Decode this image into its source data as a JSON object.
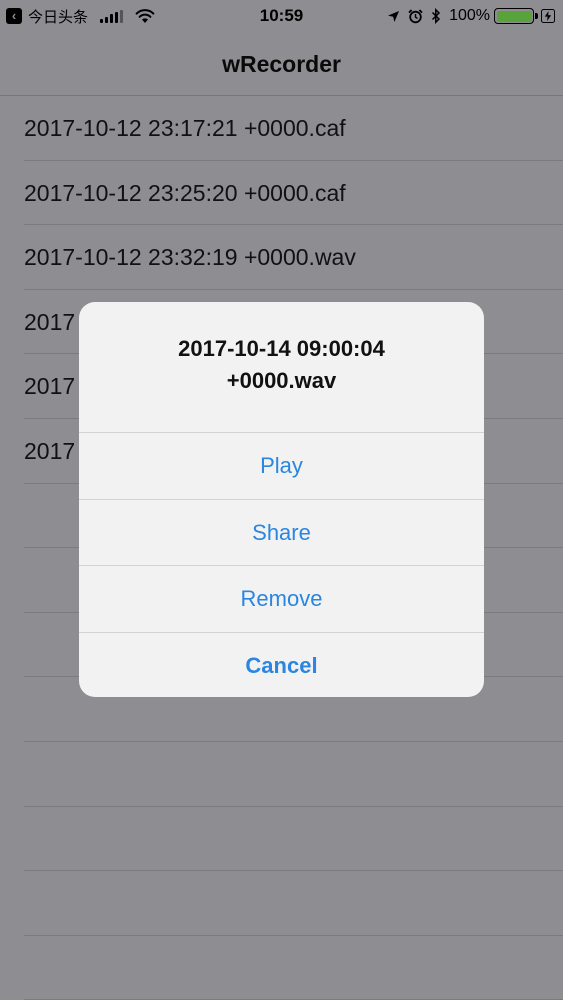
{
  "status_bar": {
    "back_app": "今日头条",
    "time": "10:59",
    "battery_percent": "100%",
    "battery_level": 1.0,
    "icons": [
      "back-arrow-icon",
      "signal-icon",
      "wifi-icon",
      "location-icon",
      "alarm-icon",
      "bluetooth-icon",
      "battery-icon",
      "charging-icon"
    ]
  },
  "nav": {
    "title": "wRecorder"
  },
  "list": {
    "rows": [
      {
        "label": "2017-10-12 23:17:21 +0000.caf"
      },
      {
        "label": "2017-10-12 23:25:20 +0000.caf"
      },
      {
        "label": "2017-10-12 23:32:19 +0000.wav"
      },
      {
        "label": "2017"
      },
      {
        "label": "2017"
      },
      {
        "label": "2017"
      },
      {
        "label": ""
      },
      {
        "label": ""
      },
      {
        "label": ""
      },
      {
        "label": ""
      },
      {
        "label": ""
      },
      {
        "label": ""
      },
      {
        "label": ""
      },
      {
        "label": ""
      }
    ]
  },
  "alert": {
    "title_line1": "2017-10-14 09:00:04",
    "title_line2": "+0000.wav",
    "actions": {
      "play": "Play",
      "share": "Share",
      "remove": "Remove",
      "cancel": "Cancel"
    }
  },
  "colors": {
    "dimmed_background": "#8e8d92",
    "alert_background": "#f2f2f2",
    "action_tint": "#2a86e0",
    "battery_fill": "#58a43b"
  }
}
